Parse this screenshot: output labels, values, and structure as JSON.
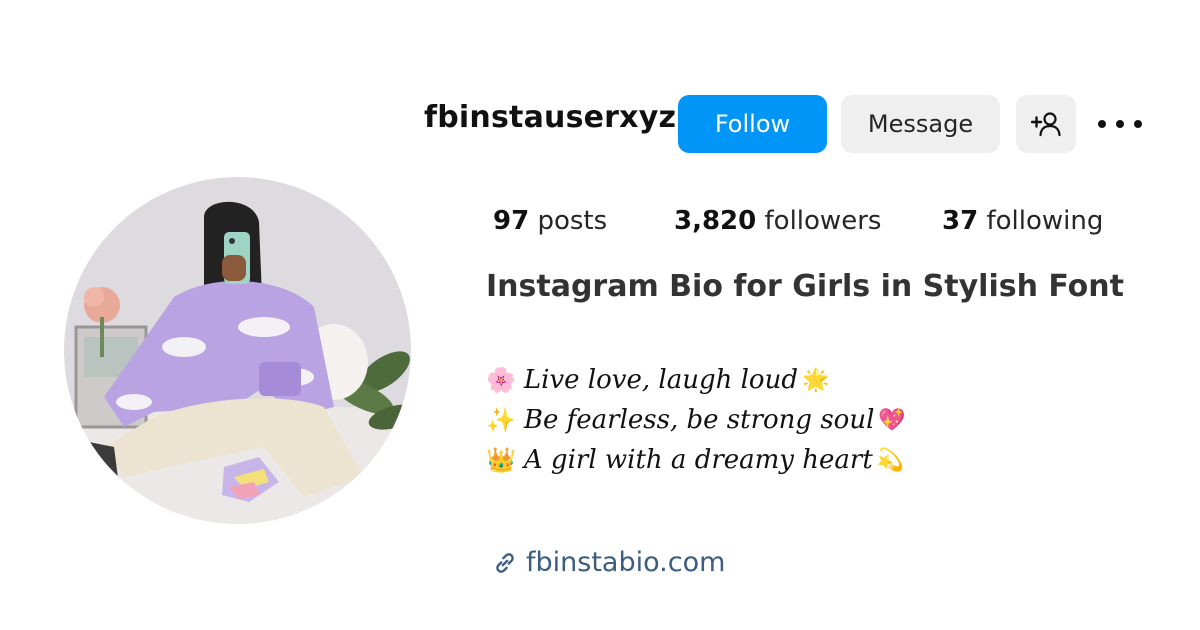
{
  "profile": {
    "username": "fbinstauserxyz",
    "follow_label": "Follow",
    "message_label": "Message",
    "stats": {
      "posts_count": "97",
      "posts_label": "posts",
      "followers_count": "3,820",
      "followers_label": "followers",
      "following_count": "37",
      "following_label": "following"
    },
    "bio_title": "Instagram Bio for Girls in Stylish Font",
    "bio_lines": [
      {
        "emoji": "🌸",
        "text": "Live love, laugh loud",
        "emoji_after": "🌟"
      },
      {
        "emoji": "✨",
        "text": "Be fearless, be strong soul",
        "emoji_after": "💖"
      },
      {
        "emoji": "👑",
        "text": "A girl with a dreamy heart",
        "emoji_after": "💫"
      }
    ],
    "link": "fbinstabio.com"
  },
  "colors": {
    "follow_blue": "#0095f6",
    "secondary_button": "#efefef",
    "link_color": "#3b5d80"
  },
  "icons": {
    "suggest": "add-person-icon",
    "more": "more-options-icon",
    "link": "link-icon"
  }
}
